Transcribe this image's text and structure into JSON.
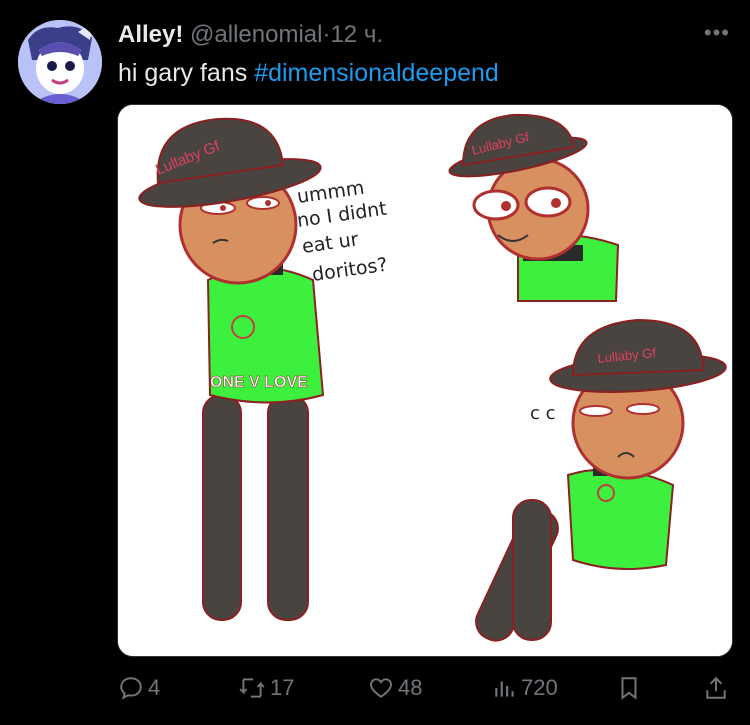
{
  "tweet": {
    "display_name": "Alley!",
    "handle": "@allenomial",
    "separator": "·",
    "time": "12 ч.",
    "text_plain": "hi gary fans ",
    "hashtag": "#dimensionaldeepend",
    "more_icon": "more-horizontal-icon"
  },
  "media": {
    "hat_text_1": "Lullaby Gf",
    "hat_text_2": "Lullaby Gf",
    "hat_text_3": "Lullaby Gf",
    "speech_line_1": "ummm",
    "speech_line_2": "no I didnt",
    "speech_line_3": "eat ur",
    "speech_line_4": "doritos?",
    "shirt_text": "ONE V LOVE",
    "sound_marks": "c c"
  },
  "actions": {
    "replies": "4",
    "retweets": "17",
    "likes": "48",
    "views": "720",
    "icons": [
      "reply-icon",
      "retweet-icon",
      "like-icon",
      "views-icon",
      "bookmark-icon",
      "share-icon"
    ]
  },
  "colors": {
    "background": "#000000",
    "text": "#e7e9ea",
    "muted": "#71767b",
    "accent": "#1d9bf0",
    "shirt_green": "#3df03d",
    "hat_brown": "#4a4440"
  }
}
